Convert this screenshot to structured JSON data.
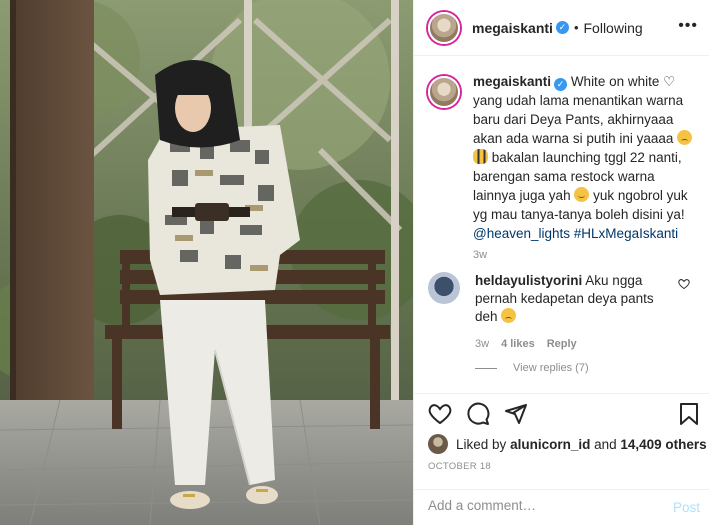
{
  "header": {
    "username": "megaiskanti",
    "separator": "•",
    "follow_status": "Following",
    "more_label": "•••"
  },
  "caption": {
    "username": "megaiskanti",
    "part1": "White on white",
    "part2": "yang udah lama menantikan warna baru dari Deya Pants, akhirnyaaa akan ada warna si putih ini yaaaa",
    "part3": "bakalan launching tggl 22 nanti, barengan sama restock warna lainnya juga yah",
    "part4": "yuk ngobrol yuk yg mau tanya-tanya boleh disini ya!",
    "mention": "@heaven_lights",
    "hashtag": "#HLxMegaIskanti",
    "time": "3w"
  },
  "comment": {
    "username": "heldayulistyorini",
    "text": "Aku ngga pernah kedapetan deya pants deh",
    "time": "3w",
    "likes": "4 likes",
    "reply": "Reply",
    "view_replies": "View replies (7)"
  },
  "likes": {
    "prefix": "Liked by",
    "user": "alunicorn_id",
    "and": "and",
    "count": "14,409 others"
  },
  "date": "OCTOBER 18",
  "add_comment": {
    "placeholder": "Add a comment…",
    "post_label": "Post"
  },
  "icons": [
    "verified-icon",
    "more-icon",
    "heart-icon",
    "comment-icon",
    "share-icon",
    "bookmark-icon"
  ],
  "colors": {
    "link": "#00376b",
    "verified": "#3897f0",
    "muted": "#8e8e8e",
    "post_disabled": "#b2dffc"
  }
}
